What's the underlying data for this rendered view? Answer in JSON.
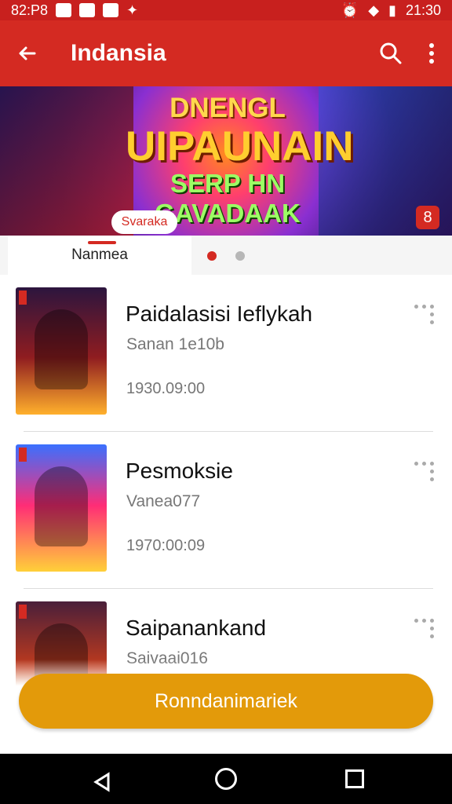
{
  "status": {
    "time_left": "82:P8",
    "time_right": "21:30"
  },
  "appbar": {
    "title": "Indansia",
    "back_icon": "arrow-left-icon",
    "search_icon": "search-icon",
    "menu_icon": "more-vertical-icon"
  },
  "banner": {
    "title_line1": "DNENGL",
    "title_line2": "UIPAUNAIN",
    "subtitle": "SERP HN GAVADAAK",
    "chip_label": "Svaraka",
    "badge_label": "8"
  },
  "tabs": {
    "active_label": "Nanmea",
    "dot_active_color": "#d42a22",
    "dot_inactive_color": "#b7b7b7"
  },
  "list": [
    {
      "title": "Paidalasisi Ieflykah",
      "subtitle": "Sanan 1e10b",
      "meta": "1930.09:00"
    },
    {
      "title": "Pesmoksie",
      "subtitle": "Vanea077",
      "meta": "1970:00:09"
    },
    {
      "title": "Saipanankand",
      "subtitle": "Saivaai016",
      "meta": ""
    }
  ],
  "action_button": {
    "label": "Ronndanimariek"
  },
  "colors": {
    "primary": "#d42a22",
    "accent": "#e39a0a"
  }
}
